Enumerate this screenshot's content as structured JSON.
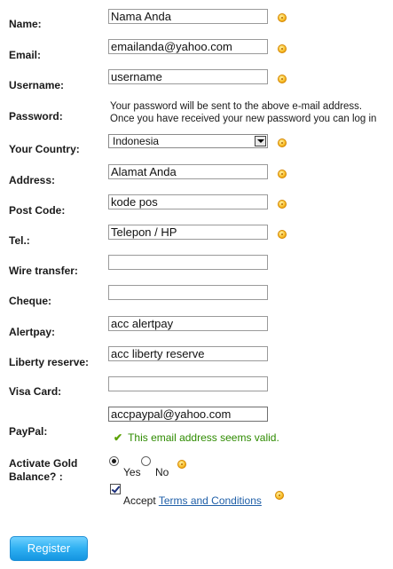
{
  "form": {
    "name": {
      "label": "Name:",
      "value": "Nama Anda"
    },
    "email": {
      "label": "Email:",
      "value": "emailanda@yahoo.com"
    },
    "username": {
      "label": "Username:",
      "value": "username"
    },
    "password": {
      "label": "Password:",
      "note_line1": "Your password will be sent to the above e-mail address.",
      "note_line2": "Once you have received your new password you can log in"
    },
    "country": {
      "label": "Your Country:",
      "selected": "Indonesia"
    },
    "address": {
      "label": "Address:",
      "value": "Alamat Anda"
    },
    "postcode": {
      "label": "Post Code:",
      "value": "kode pos"
    },
    "tel": {
      "label": "Tel.:",
      "value": "Telepon / HP"
    },
    "wire": {
      "label": "Wire transfer:",
      "value": ""
    },
    "cheque": {
      "label": "Cheque:",
      "value": ""
    },
    "alertpay": {
      "label": "Alertpay:",
      "value": "acc alertpay"
    },
    "liberty": {
      "label": "Liberty reserve:",
      "value": "acc liberty reserve"
    },
    "visa": {
      "label": "Visa Card:",
      "value": ""
    },
    "paypal": {
      "label": "PayPal:",
      "value": "accpaypal@yahoo.com",
      "valid_message": "This email address seems valid."
    },
    "gold": {
      "label_line1": "Activate Gold",
      "label_line2": "Balance? :",
      "yes_label": "Yes",
      "no_label": "No",
      "selected": "Yes"
    },
    "terms": {
      "accept_text": "Accept",
      "link_text": "Terms and Conditions",
      "checked": true
    },
    "register_label": "Register"
  },
  "icons": {
    "help": "help-dot-icon",
    "valid": "checkmark-icon",
    "dropdown": "chevron-down-icon"
  },
  "colors": {
    "help_icon": "#f9c12e",
    "valid_text": "#2e8b00",
    "link": "#1f5fa8",
    "button": "#2fb0f2"
  }
}
